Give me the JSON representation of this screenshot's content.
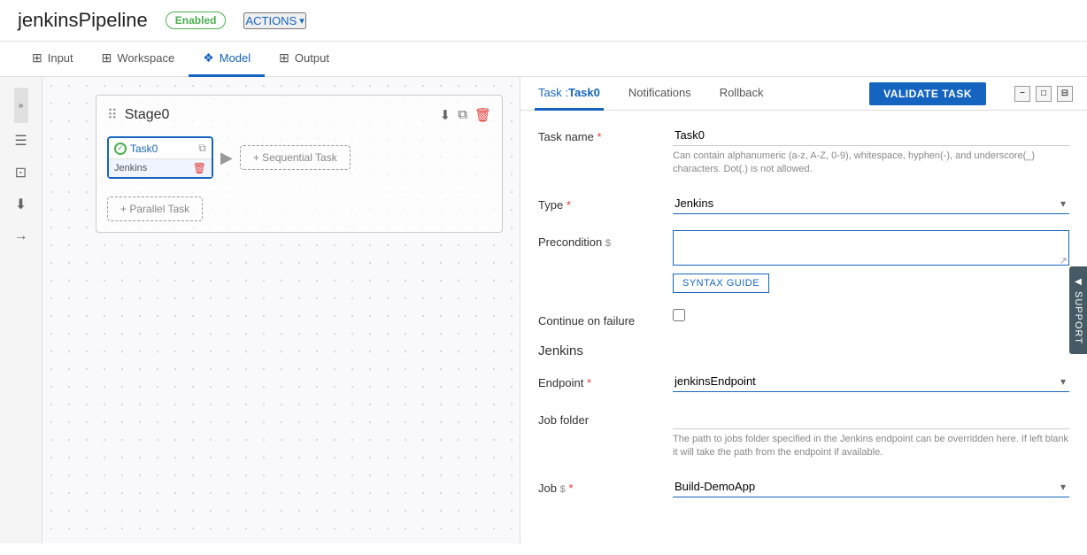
{
  "header": {
    "title": "jenkinsPipeline",
    "badge": "Enabled",
    "actions_label": "ACTIONS"
  },
  "tabs": [
    {
      "id": "input",
      "label": "Input",
      "icon": "⊞",
      "active": false
    },
    {
      "id": "workspace",
      "label": "Workspace",
      "icon": "⊞",
      "active": false
    },
    {
      "id": "model",
      "label": "Model",
      "icon": "⊞",
      "active": true
    },
    {
      "id": "output",
      "label": "Output",
      "icon": "⊞",
      "active": false
    }
  ],
  "canvas": {
    "stage_title": "Stage0",
    "task_name": "Task0",
    "task_type": "Jenkins",
    "add_sequential_label": "+ Sequential Task",
    "add_parallel_label": "+ Parallel Task"
  },
  "panel": {
    "tabs": [
      {
        "id": "task",
        "label": "Task :",
        "task_ref": "Task0",
        "active": true
      },
      {
        "id": "notifications",
        "label": "Notifications",
        "active": false
      },
      {
        "id": "rollback",
        "label": "Rollback",
        "active": false
      }
    ],
    "validate_label": "VALIDATE TASK",
    "task_name_label": "Task name",
    "task_name_value": "Task0",
    "task_name_hint": "Can contain alphanumeric (a-z, A-Z, 0-9), whitespace, hyphen(-), and underscore(_) characters. Dot(.) is not allowed.",
    "type_label": "Type",
    "type_value": "Jenkins",
    "precondition_label": "Precondition",
    "precondition_value": "",
    "syntax_guide_label": "SYNTAX GUIDE",
    "continue_failure_label": "Continue on failure",
    "jenkins_section_title": "Jenkins",
    "endpoint_label": "Endpoint",
    "endpoint_value": "jenkinsEndpoint",
    "job_folder_label": "Job folder",
    "job_folder_hint": "The path to jobs folder specified in the Jenkins endpoint can be overridden here. If left blank it will take the path from the endpoint if available.",
    "job_label": "Job",
    "job_value": "Build-DemoApp",
    "support_label": "SUPPORT"
  }
}
